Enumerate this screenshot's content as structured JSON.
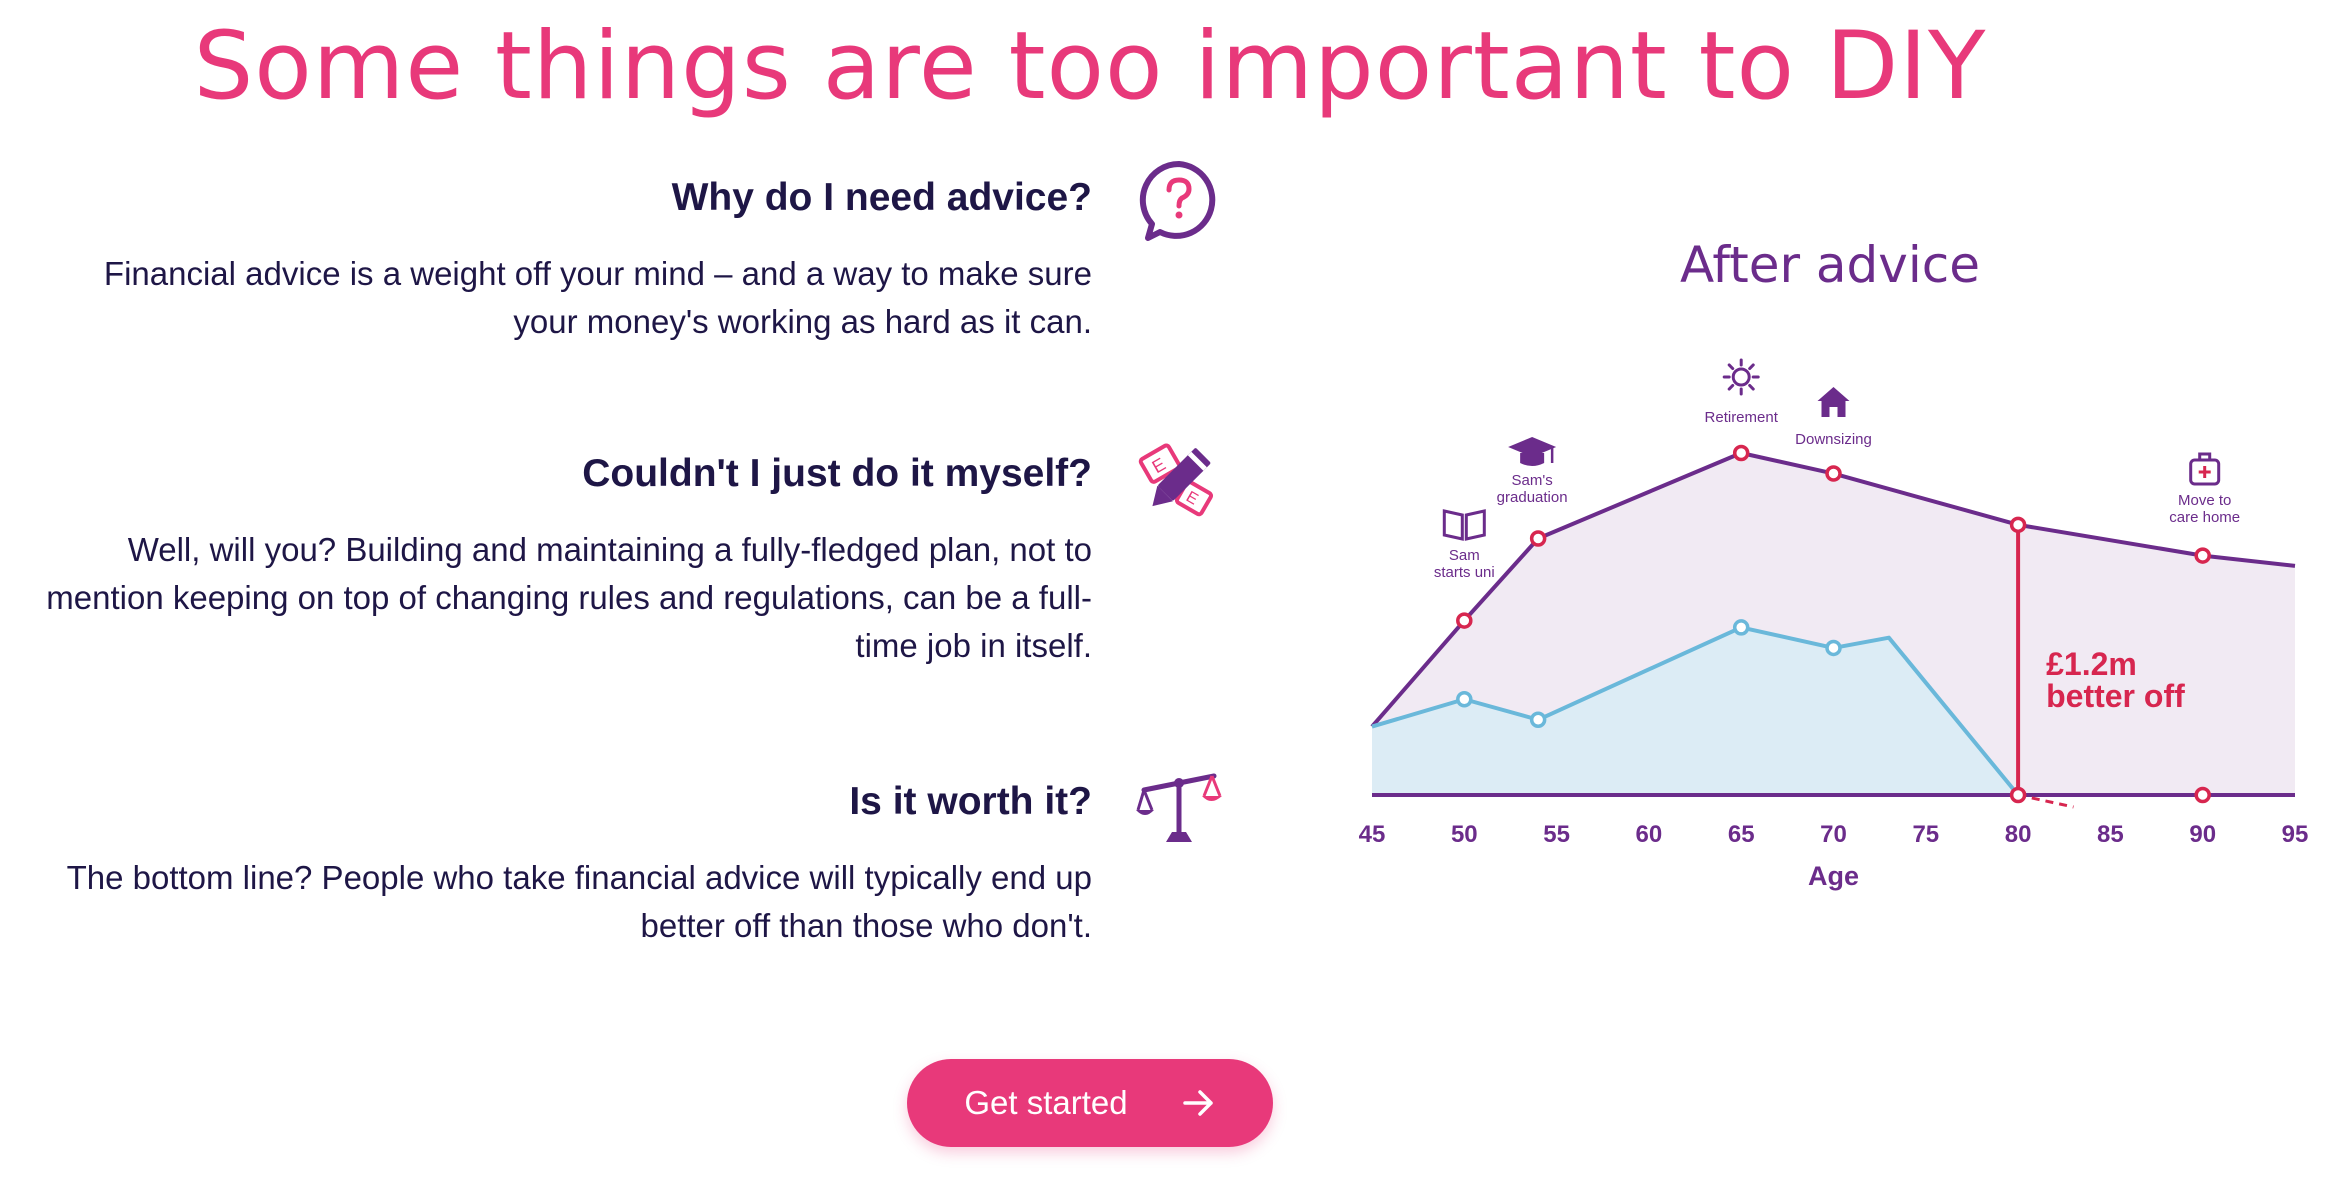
{
  "headline": "Some things are too important to DIY",
  "faq": [
    {
      "question": "Why do I need advice?",
      "answer": "Financial advice is a weight off your mind – and a way to make sure your money's working as hard as it can.",
      "icon": "question-speech-bubble-icon"
    },
    {
      "question": "Couldn't I just do it myself?",
      "answer": "Well, will you? Building and maintaining a fully-fledged plan, not to mention keeping on top of changing rules and regulations, can be a full-time job in itself.",
      "icon": "pencil-paper-icon"
    },
    {
      "question": "Is it worth it?",
      "answer": "The bottom line? People who take financial advice will typically end up better off than those who don't.",
      "icon": "scales-icon"
    }
  ],
  "cta": {
    "label": "Get started",
    "icon": "arrow-right-icon"
  },
  "colors": {
    "brand_pink": "#e8397a",
    "navy_text": "#1e1646",
    "purple": "#6b2c8b",
    "marker_red": "#d7264f",
    "light_blue": "#6ab8da",
    "after_fill": "#f1eaf3",
    "before_fill": "#dcecf5"
  },
  "chart_data": {
    "type": "area",
    "title": "After advice",
    "xlabel": "Age",
    "ylabel": "",
    "xticks": [
      45,
      50,
      55,
      60,
      65,
      70,
      75,
      80,
      85,
      90,
      95
    ],
    "xlim": [
      45,
      95
    ],
    "ylim": [
      0,
      100
    ],
    "series": [
      {
        "values": [
          [
            45,
            20
          ],
          [
            50,
            51
          ],
          [
            54,
            75
          ],
          [
            65,
            100
          ],
          [
            70,
            94
          ],
          [
            80,
            79
          ],
          [
            90,
            70
          ],
          [
            95,
            67
          ]
        ],
        "markers_at": [
          50,
          54,
          65,
          70,
          80,
          90
        ],
        "color": "#6b2c8b"
      },
      {
        "values": [
          [
            45,
            20
          ],
          [
            50,
            28
          ],
          [
            54,
            22
          ],
          [
            65,
            49
          ],
          [
            70,
            43
          ],
          [
            73,
            46
          ],
          [
            80,
            0
          ]
        ],
        "markers_at": [
          50,
          54,
          65,
          70
        ],
        "color": "#6ab8da"
      }
    ],
    "milestones": [
      {
        "label": "Sam starts uni",
        "icon": "open-book-icon",
        "x": 50
      },
      {
        "label": "Sam's graduation",
        "icon": "graduation-cap-icon",
        "x": 54
      },
      {
        "label": "Retirement",
        "icon": "sun-icon",
        "x": 65
      },
      {
        "label": "Downsizing",
        "icon": "house-icon",
        "x": 70
      },
      {
        "label": "Move to care home",
        "icon": "medical-kit-icon",
        "x": 90
      }
    ],
    "annotation": {
      "text": "£1.2m better off",
      "x": 80
    },
    "baseline_markers": [
      80,
      90
    ]
  }
}
